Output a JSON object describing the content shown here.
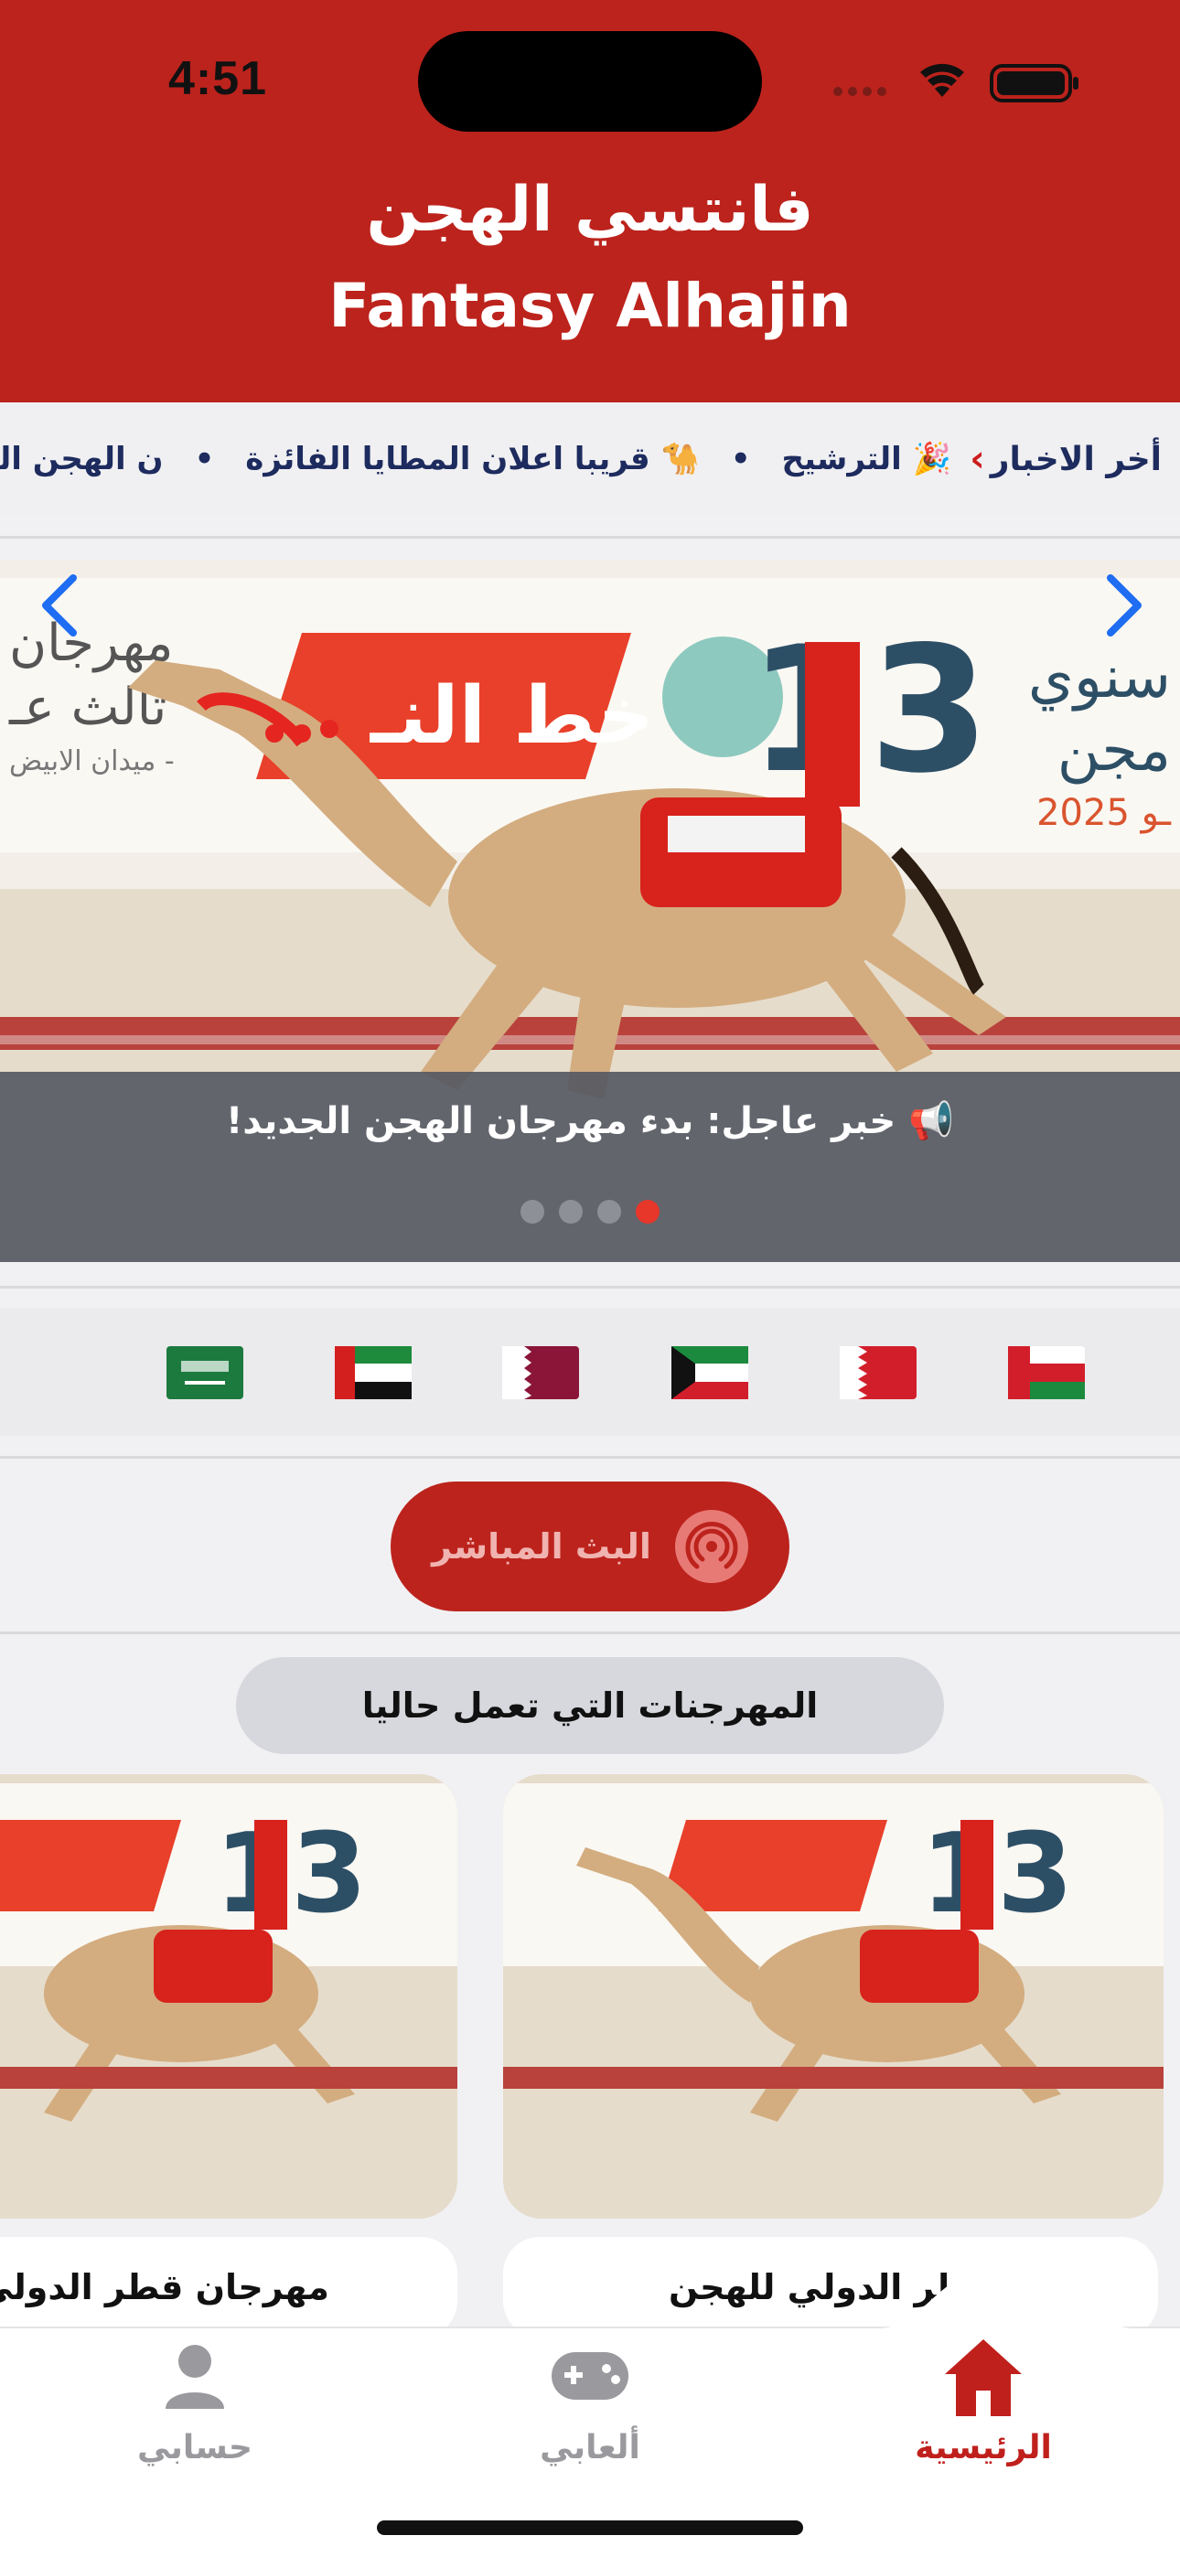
{
  "status_bar": {
    "time": "4:51"
  },
  "header": {
    "title_ar": "فانتسي الهجن",
    "title_en": "Fantasy Alhajin"
  },
  "ticker": {
    "label": "أخر الاخبار",
    "items": [
      "🎉 الترشيح",
      "🐪 قريبا اعلان المطايا الفائزة",
      "ن الهجن الجديد!"
    ]
  },
  "slider": {
    "caption": "📢 خبر عاجل: بدء مهرجان الهجن الجديد!",
    "banner_text_right": "سنوي",
    "banner_text_right2": "مجن",
    "banner_year": "2025 ـو",
    "banner_number": "13",
    "banner_text_left": "مهرجان",
    "banner_text_left2": "ثالث عـ",
    "banner_text_left3": "ميدان الابيض -",
    "banner_red": "خط النـ",
    "dots_count": 4,
    "active_dot": 3
  },
  "flags": [
    "saudi-arabia",
    "uae",
    "qatar",
    "kuwait",
    "bahrain",
    "oman"
  ],
  "live_button": {
    "label": "البث المباشر"
  },
  "festivals": {
    "section_title": "المهرجنات التي تعمل حاليا",
    "cards": [
      {
        "title": "قطر الدولي للهجن"
      },
      {
        "title": "مهرجان قطر الدولي للـ"
      }
    ]
  },
  "tabs": [
    {
      "label": "الرئيسية",
      "icon": "home-icon",
      "active": true
    },
    {
      "label": "ألعابي",
      "icon": "gamepad-icon",
      "active": false
    },
    {
      "label": "حسابي",
      "icon": "person-icon",
      "active": false
    }
  ],
  "colors": {
    "brand_red": "#bc231c",
    "navy": "#1d2b5e",
    "active_dot": "#e6372a"
  }
}
